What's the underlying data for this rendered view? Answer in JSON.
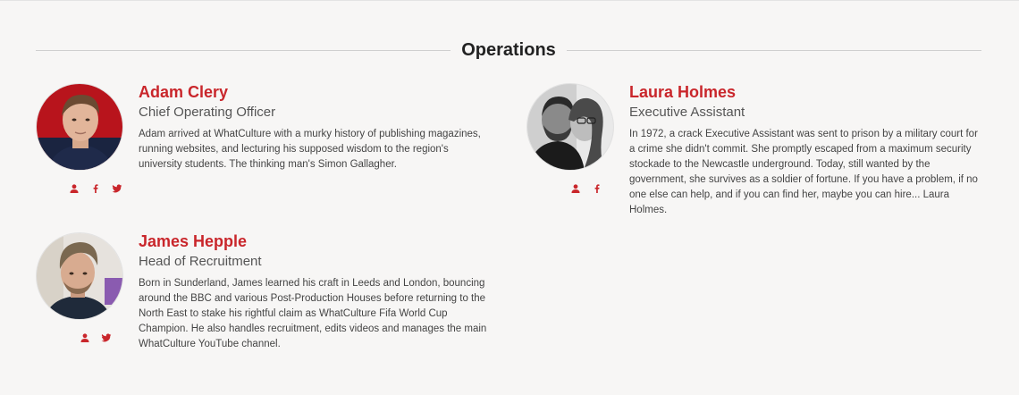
{
  "section": {
    "title": "Operations"
  },
  "members": [
    {
      "name": "Adam Clery",
      "role": "Chief Operating Officer",
      "bio": "Adam arrived at WhatCulture with a murky history of publishing magazines, running websites, and lecturing his supposed wisdom to the region's university students. The thinking man's Simon Gallagher.",
      "socials": [
        "profile-icon",
        "facebook-icon",
        "twitter-icon"
      ]
    },
    {
      "name": "Laura Holmes",
      "role": "Executive Assistant",
      "bio": "In 1972, a crack Executive Assistant was sent to prison by a military court for a crime she didn't commit. She promptly escaped from a maximum security stockade to the Newcastle underground. Today, still wanted by the government, she survives as a soldier of fortune. If you have a problem, if no one else can help, and if you can find her, maybe you can hire... Laura Holmes.",
      "socials": [
        "profile-icon",
        "facebook-icon"
      ]
    },
    {
      "name": "James Hepple",
      "role": "Head of Recruitment",
      "bio": "Born in Sunderland, James learned his craft in Leeds and London, bouncing around the BBC and various Post-Production Houses before returning to the North East to stake his rightful claim as WhatCulture Fifa World Cup Champion. He also handles recruitment, edits videos and manages the main WhatCulture YouTube channel.",
      "socials": [
        "profile-icon",
        "twitter-icon"
      ]
    }
  ],
  "colors": {
    "accent": "#c9262b",
    "background": "#f7f6f5",
    "heading": "#222222"
  }
}
